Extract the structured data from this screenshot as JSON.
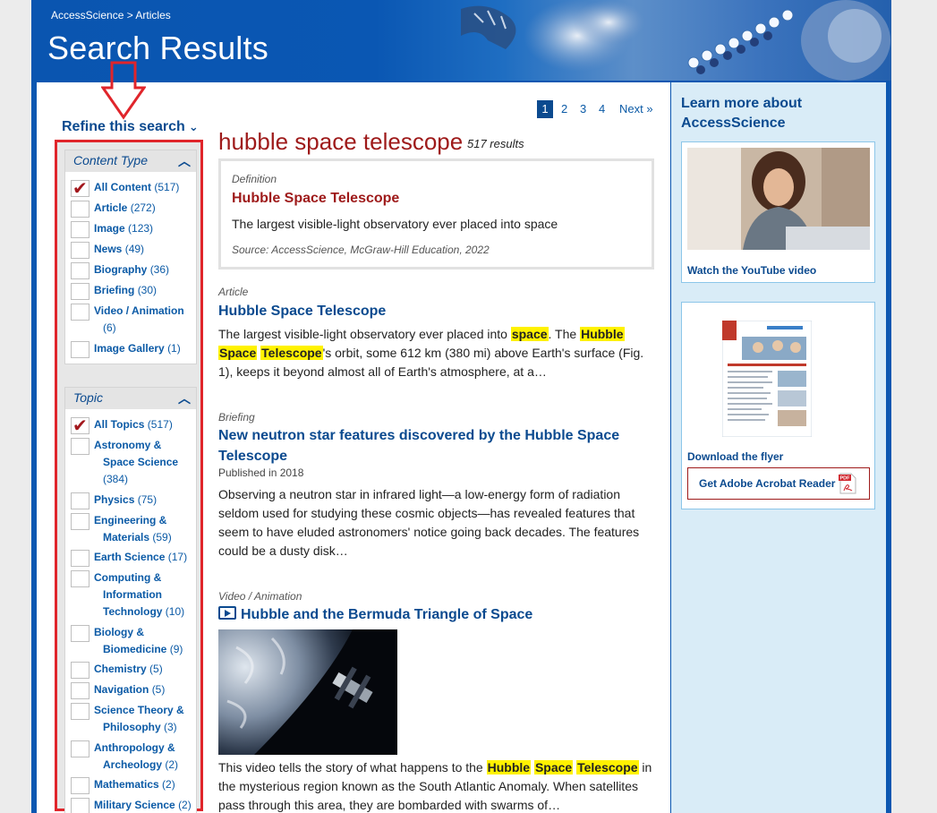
{
  "header": {
    "breadcrumb_home": "AccessScience",
    "breadcrumb_sep": ">",
    "breadcrumb_current": "Articles",
    "title": "Search Results"
  },
  "refine": {
    "label": "Refine this search"
  },
  "facets": {
    "content_type": {
      "heading": "Content Type",
      "options": [
        {
          "label": "All Content",
          "count": "(517)",
          "checked": true
        },
        {
          "label": "Article",
          "count": "(272)"
        },
        {
          "label": "Image",
          "count": "(123)"
        },
        {
          "label": "News",
          "count": "(49)"
        },
        {
          "label": "Biography",
          "count": "(36)"
        },
        {
          "label": "Briefing",
          "count": "(30)"
        },
        {
          "label": "Video / Animation",
          "count": "(6)"
        },
        {
          "label": "Image Gallery",
          "count": "(1)"
        }
      ]
    },
    "topic": {
      "heading": "Topic",
      "options": [
        {
          "label": "All Topics",
          "count": "(517)",
          "checked": true
        },
        {
          "label": "Astronomy & Space Science",
          "count": "(384)"
        },
        {
          "label": "Physics",
          "count": "(75)"
        },
        {
          "label": "Engineering & Materials",
          "count": "(59)"
        },
        {
          "label": "Earth Science",
          "count": "(17)"
        },
        {
          "label": "Computing & Information Technology",
          "count": "(10)"
        },
        {
          "label": "Biology & Biomedicine",
          "count": "(9)"
        },
        {
          "label": "Chemistry",
          "count": "(5)"
        },
        {
          "label": "Navigation",
          "count": "(5)"
        },
        {
          "label": "Science Theory & Philosophy",
          "count": "(3)"
        },
        {
          "label": "Anthropology & Archeology",
          "count": "(2)"
        },
        {
          "label": "Mathematics",
          "count": "(2)"
        },
        {
          "label": "Military Science",
          "count": "(2)"
        }
      ]
    }
  },
  "pager": {
    "pages": [
      "1",
      "2",
      "3",
      "4"
    ],
    "current": "1",
    "next": "Next »"
  },
  "search": {
    "query": "hubble space telescope",
    "count": "517 results"
  },
  "definition": {
    "type": "Definition",
    "title": "Hubble Space Telescope",
    "text": "The largest visible-light observatory ever placed into space",
    "source": "Source: AccessScience, McGraw-Hill Education, 2022"
  },
  "results": [
    {
      "type": "Article",
      "title": "Hubble Space Telescope",
      "snippet": [
        {
          "t": "The largest visible-light observatory ever placed into "
        },
        {
          "t": "space",
          "hl": true
        },
        {
          "t": ". The "
        },
        {
          "t": "Hubble",
          "hl": true
        },
        {
          "t": " "
        },
        {
          "t": "Space",
          "hl": true
        },
        {
          "t": " "
        },
        {
          "t": "Telescope",
          "hl": true
        },
        {
          "t": "'s orbit, some 612 km (380 mi) above Earth's surface (Fig. 1), keeps it beyond almost all of Earth's atmosphere, at a…"
        }
      ]
    },
    {
      "type": "Briefing",
      "title": "New neutron star features discovered by the Hubble Space Telescope",
      "meta": "Published in 2018",
      "snippet": [
        {
          "t": "Observing a neutron star in infrared light—a low-energy form of radiation seldom used for studying these cosmic objects—has revealed features that seem to have eluded astronomers' notice going back decades. The features could be a dusty disk…"
        }
      ]
    },
    {
      "type": "Video / Animation",
      "title": "Hubble and the Bermuda Triangle of Space",
      "snippet": [
        {
          "t": "This video tells the story of what happens to the "
        },
        {
          "t": "Hubble",
          "hl": true
        },
        {
          "t": " "
        },
        {
          "t": "Space",
          "hl": true
        },
        {
          "t": " "
        },
        {
          "t": "Telescope",
          "hl": true
        },
        {
          "t": " in the mysterious region known as the South Atlantic Anomaly. When satellites pass through this area, they are bombarded with swarms of…"
        }
      ]
    }
  ],
  "sidebar": {
    "title": "Learn more about AccessScience",
    "youtube_link": "Watch the YouTube video",
    "flyer_link": "Download the flyer",
    "acrobat_label": "Get Adobe Acrobat Reader",
    "pdf_badge": "PDF"
  },
  "colors": {
    "brand_blue": "#0b57b1",
    "link_blue": "#0b4a8f",
    "title_red": "#9e1a1a",
    "highlight": "#fff200",
    "annotation_red": "#e0252b"
  }
}
